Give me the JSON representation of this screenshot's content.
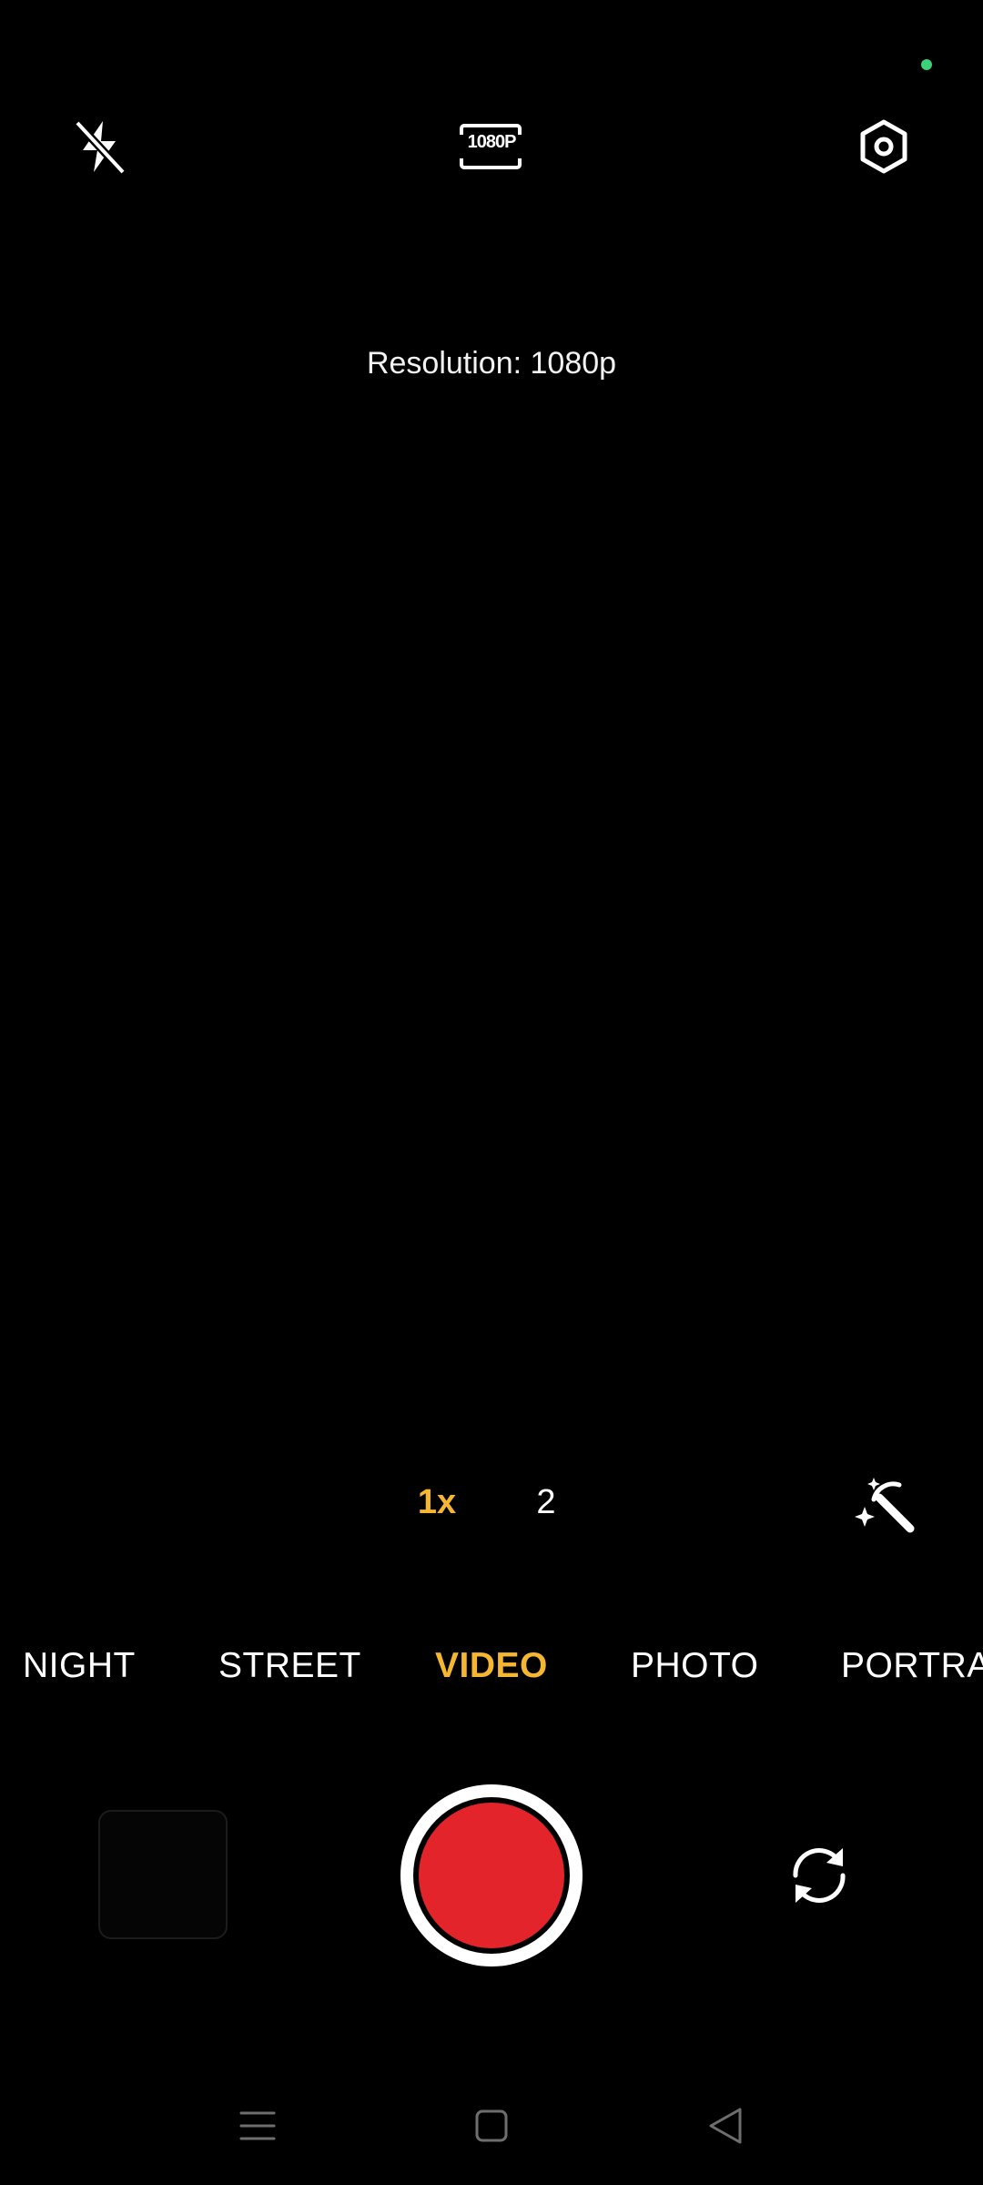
{
  "colors": {
    "accent": "#F5B731",
    "record": "#E3242B",
    "status_dot": "#3DD17A",
    "text": "#FFFFFF",
    "nav_gray": "#6E6E6E"
  },
  "top_bar": {
    "flash_icon": "flash-off-icon",
    "resolution_badge": "1080P",
    "settings_icon": "settings-icon"
  },
  "viewfinder": {
    "resolution_text": "Resolution: 1080p"
  },
  "zoom": {
    "options": [
      "1x",
      "2"
    ],
    "selected": "1x"
  },
  "beauty_icon": "magic-wand-icon",
  "modes": {
    "items": [
      "NIGHT",
      "STREET",
      "VIDEO",
      "PHOTO",
      "PORTRA"
    ],
    "selected": "VIDEO"
  },
  "controls": {
    "gallery_icon": "gallery-thumbnail",
    "record_icon": "record-button",
    "switch_icon": "switch-camera-icon"
  },
  "nav": {
    "menu_icon": "menu-icon",
    "home_icon": "home-icon",
    "back_icon": "back-icon"
  }
}
